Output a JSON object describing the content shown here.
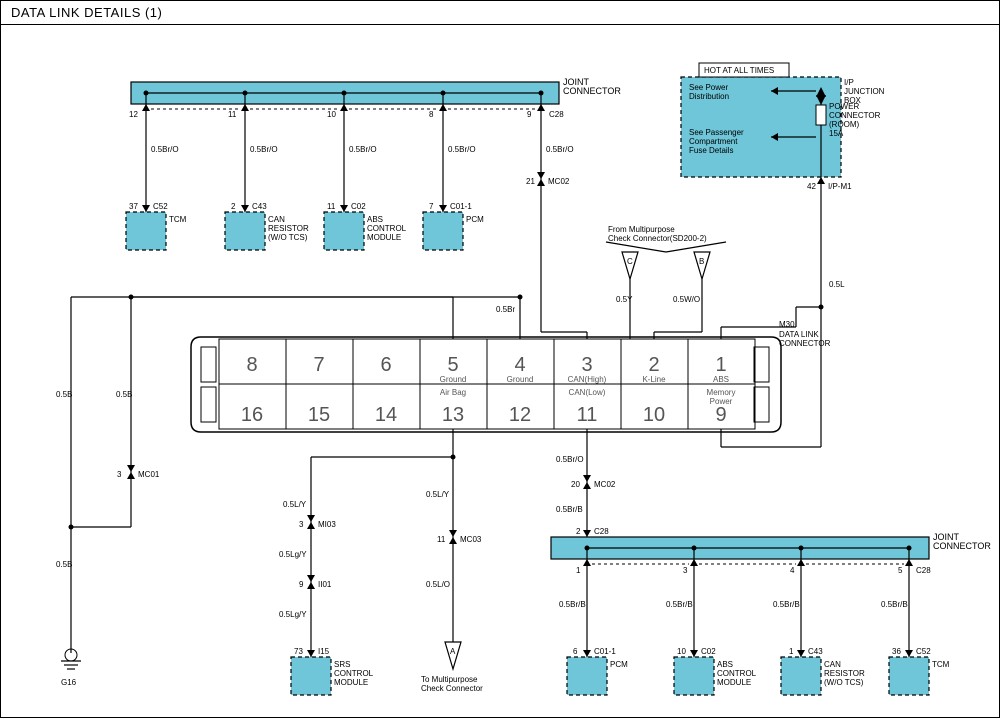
{
  "title": "DATA LINK DETAILS (1)",
  "hot_label": "HOT AT ALL TIMES",
  "junction_box": {
    "label": "I/P\nJUNCTION\nBOX",
    "power_conn": "POWER\nCONNECTOR\n(ROOM)\n15A",
    "see_power": "See Power\nDistribution",
    "see_pass": "See Passenger\nCompartment\nFuse Details",
    "ip_m1": "I/P-M1",
    "pin42": "42"
  },
  "joint_top": {
    "label": "JOINT\nCONNECTOR",
    "conn": "C28",
    "pins": [
      "12",
      "11",
      "10",
      "8",
      "9"
    ]
  },
  "joint_bot": {
    "label": "JOINT\nCONNECTOR",
    "conn": "C28",
    "in_pin": "2",
    "pins": [
      "1",
      "3",
      "4",
      "5"
    ]
  },
  "wires_top": [
    "0.5Br/O",
    "0.5Br/O",
    "0.5Br/O",
    "0.5Br/O",
    "0.5Br/O"
  ],
  "boxes_top": [
    {
      "pin": "37",
      "conn": "C52",
      "name": "TCM"
    },
    {
      "pin": "2",
      "conn": "C43",
      "name": "CAN\nRESISTOR\n(W/O TCS)"
    },
    {
      "pin": "11",
      "conn": "C02",
      "name": "ABS\nCONTROL\nMODULE"
    },
    {
      "pin": "7",
      "conn": "C01-1",
      "name": "PCM"
    }
  ],
  "wires_bot": [
    "0.5Br/B",
    "0.5Br/B",
    "0.5Br/B",
    "0.5Br/B"
  ],
  "boxes_bot": [
    {
      "pin": "6",
      "conn": "C01-1",
      "name": "PCM"
    },
    {
      "pin": "10",
      "conn": "C02",
      "name": "ABS\nCONTROL\nMODULE"
    },
    {
      "pin": "1",
      "conn": "C43",
      "name": "CAN\nRESISTOR\n(W/O TCS)"
    },
    {
      "pin": "36",
      "conn": "C52",
      "name": "TCM"
    }
  ],
  "mc02_top": {
    "pin": "21",
    "conn": "MC02"
  },
  "mc02_bot": {
    "pin": "20",
    "conn": "MC02",
    "wire_above": "0.5Br/O",
    "wire_below": "0.5Br/B"
  },
  "multicheck": {
    "label": "From Multipurpose\nCheck Connector(SD200-2)",
    "c": "C",
    "b": "B",
    "wire_c": "0.5Y",
    "wire_b": "0.5W/O"
  },
  "power_wire": "0.5L",
  "dlc": {
    "ref": "M30",
    "name": "DATA LINK\nCONNECTOR",
    "row1": [
      "8",
      "7",
      "6",
      "5",
      "4",
      "3",
      "2",
      "1"
    ],
    "row2": [
      "16",
      "15",
      "14",
      "13",
      "12",
      "11",
      "10",
      "9"
    ],
    "labels_top": {
      "5": "Ground",
      "4": "Ground",
      "3": "CAN(High)",
      "2": "K-Line",
      "1": "ABS"
    },
    "labels_bot": {
      "13": "Air Bag",
      "11": "CAN(Low)",
      "9": "Memory\nPower"
    }
  },
  "left_ground": {
    "wire1": "0.5B",
    "wire2": "0.5B",
    "wire3": "0.5B",
    "mc01": "MC01",
    "pin3": "3",
    "gnd": "G16"
  },
  "pin4_wire": "0.5Br",
  "srs_path": {
    "w1": "0.5L/Y",
    "mi03_pin": "3",
    "mi03": "MI03",
    "w2": "0.5Lg/Y",
    "ii01_pin": "9",
    "ii01": "II01",
    "w3": "0.5Lg/Y",
    "i15_pin": "73",
    "i15": "I15",
    "name": "SRS\nCONTROL\nMODULE"
  },
  "mc03_path": {
    "wire_above": "0.5L/Y",
    "pin": "11",
    "conn": "MC03",
    "wire_below": "0.5L/O",
    "tri": "A",
    "label": "To Multipurpose\nCheck Connector"
  }
}
